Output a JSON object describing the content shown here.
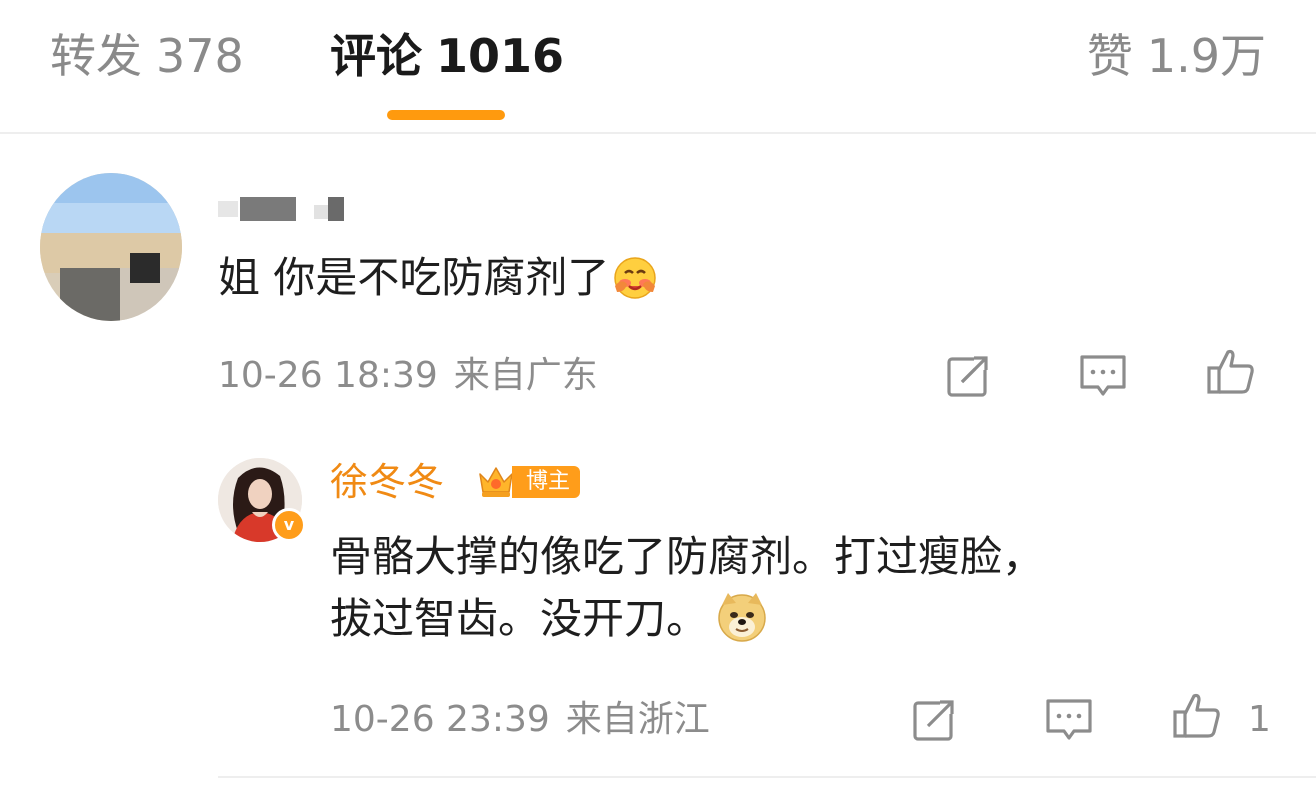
{
  "tabs": {
    "repost": {
      "label": "转发",
      "count": "378"
    },
    "comments": {
      "label": "评论",
      "count": "1016"
    },
    "likes": {
      "label": "赞",
      "count": "1.9万"
    },
    "active": "comments",
    "accent_color": "#ff9a0e"
  },
  "comment": {
    "author": "",
    "text": "姐 你是不吃防腐剂了",
    "emoji": "blushing-face-emoji",
    "time": "10-26 18:39",
    "location": "来自广东",
    "actions": [
      "repost-icon",
      "reply-icon",
      "like-icon"
    ]
  },
  "reply": {
    "author": "徐冬冬",
    "author_color": "#f08a14",
    "badge": "博主",
    "badge_color": "#ff9d1a",
    "verified_mark": "v",
    "text_line1": "骨骼大撑的像吃了防腐剂。打过瘦脸，",
    "text_line2": "拔过智齿。没开刀。",
    "emoji": "doge-emoji",
    "time": "10-26 23:39",
    "location": "来自浙江",
    "like_count": "1",
    "actions": [
      "repost-icon",
      "reply-icon",
      "like-icon"
    ]
  }
}
